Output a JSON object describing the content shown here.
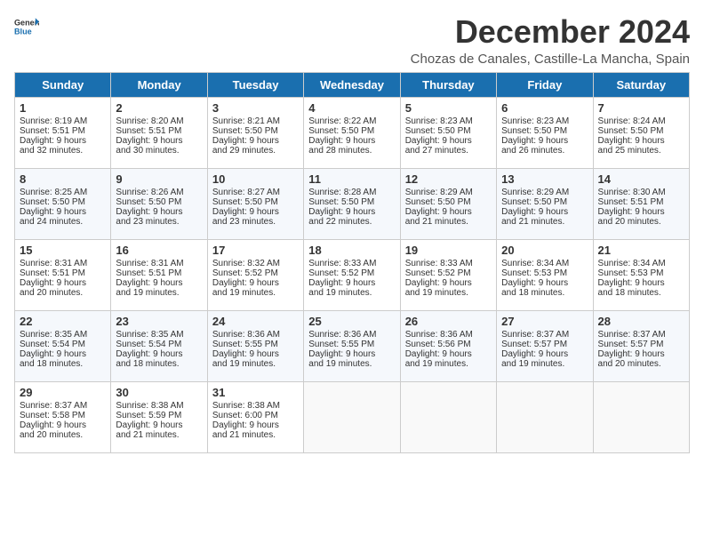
{
  "header": {
    "logo_general": "General",
    "logo_blue": "Blue",
    "title": "December 2024",
    "subtitle": "Chozas de Canales, Castille-La Mancha, Spain"
  },
  "weekdays": [
    "Sunday",
    "Monday",
    "Tuesday",
    "Wednesday",
    "Thursday",
    "Friday",
    "Saturday"
  ],
  "weeks": [
    [
      {
        "day": "1",
        "lines": [
          "Sunrise: 8:19 AM",
          "Sunset: 5:51 PM",
          "Daylight: 9 hours",
          "and 32 minutes."
        ]
      },
      {
        "day": "2",
        "lines": [
          "Sunrise: 8:20 AM",
          "Sunset: 5:51 PM",
          "Daylight: 9 hours",
          "and 30 minutes."
        ]
      },
      {
        "day": "3",
        "lines": [
          "Sunrise: 8:21 AM",
          "Sunset: 5:50 PM",
          "Daylight: 9 hours",
          "and 29 minutes."
        ]
      },
      {
        "day": "4",
        "lines": [
          "Sunrise: 8:22 AM",
          "Sunset: 5:50 PM",
          "Daylight: 9 hours",
          "and 28 minutes."
        ]
      },
      {
        "day": "5",
        "lines": [
          "Sunrise: 8:23 AM",
          "Sunset: 5:50 PM",
          "Daylight: 9 hours",
          "and 27 minutes."
        ]
      },
      {
        "day": "6",
        "lines": [
          "Sunrise: 8:23 AM",
          "Sunset: 5:50 PM",
          "Daylight: 9 hours",
          "and 26 minutes."
        ]
      },
      {
        "day": "7",
        "lines": [
          "Sunrise: 8:24 AM",
          "Sunset: 5:50 PM",
          "Daylight: 9 hours",
          "and 25 minutes."
        ]
      }
    ],
    [
      {
        "day": "8",
        "lines": [
          "Sunrise: 8:25 AM",
          "Sunset: 5:50 PM",
          "Daylight: 9 hours",
          "and 24 minutes."
        ]
      },
      {
        "day": "9",
        "lines": [
          "Sunrise: 8:26 AM",
          "Sunset: 5:50 PM",
          "Daylight: 9 hours",
          "and 23 minutes."
        ]
      },
      {
        "day": "10",
        "lines": [
          "Sunrise: 8:27 AM",
          "Sunset: 5:50 PM",
          "Daylight: 9 hours",
          "and 23 minutes."
        ]
      },
      {
        "day": "11",
        "lines": [
          "Sunrise: 8:28 AM",
          "Sunset: 5:50 PM",
          "Daylight: 9 hours",
          "and 22 minutes."
        ]
      },
      {
        "day": "12",
        "lines": [
          "Sunrise: 8:29 AM",
          "Sunset: 5:50 PM",
          "Daylight: 9 hours",
          "and 21 minutes."
        ]
      },
      {
        "day": "13",
        "lines": [
          "Sunrise: 8:29 AM",
          "Sunset: 5:50 PM",
          "Daylight: 9 hours",
          "and 21 minutes."
        ]
      },
      {
        "day": "14",
        "lines": [
          "Sunrise: 8:30 AM",
          "Sunset: 5:51 PM",
          "Daylight: 9 hours",
          "and 20 minutes."
        ]
      }
    ],
    [
      {
        "day": "15",
        "lines": [
          "Sunrise: 8:31 AM",
          "Sunset: 5:51 PM",
          "Daylight: 9 hours",
          "and 20 minutes."
        ]
      },
      {
        "day": "16",
        "lines": [
          "Sunrise: 8:31 AM",
          "Sunset: 5:51 PM",
          "Daylight: 9 hours",
          "and 19 minutes."
        ]
      },
      {
        "day": "17",
        "lines": [
          "Sunrise: 8:32 AM",
          "Sunset: 5:52 PM",
          "Daylight: 9 hours",
          "and 19 minutes."
        ]
      },
      {
        "day": "18",
        "lines": [
          "Sunrise: 8:33 AM",
          "Sunset: 5:52 PM",
          "Daylight: 9 hours",
          "and 19 minutes."
        ]
      },
      {
        "day": "19",
        "lines": [
          "Sunrise: 8:33 AM",
          "Sunset: 5:52 PM",
          "Daylight: 9 hours",
          "and 19 minutes."
        ]
      },
      {
        "day": "20",
        "lines": [
          "Sunrise: 8:34 AM",
          "Sunset: 5:53 PM",
          "Daylight: 9 hours",
          "and 18 minutes."
        ]
      },
      {
        "day": "21",
        "lines": [
          "Sunrise: 8:34 AM",
          "Sunset: 5:53 PM",
          "Daylight: 9 hours",
          "and 18 minutes."
        ]
      }
    ],
    [
      {
        "day": "22",
        "lines": [
          "Sunrise: 8:35 AM",
          "Sunset: 5:54 PM",
          "Daylight: 9 hours",
          "and 18 minutes."
        ]
      },
      {
        "day": "23",
        "lines": [
          "Sunrise: 8:35 AM",
          "Sunset: 5:54 PM",
          "Daylight: 9 hours",
          "and 18 minutes."
        ]
      },
      {
        "day": "24",
        "lines": [
          "Sunrise: 8:36 AM",
          "Sunset: 5:55 PM",
          "Daylight: 9 hours",
          "and 19 minutes."
        ]
      },
      {
        "day": "25",
        "lines": [
          "Sunrise: 8:36 AM",
          "Sunset: 5:55 PM",
          "Daylight: 9 hours",
          "and 19 minutes."
        ]
      },
      {
        "day": "26",
        "lines": [
          "Sunrise: 8:36 AM",
          "Sunset: 5:56 PM",
          "Daylight: 9 hours",
          "and 19 minutes."
        ]
      },
      {
        "day": "27",
        "lines": [
          "Sunrise: 8:37 AM",
          "Sunset: 5:57 PM",
          "Daylight: 9 hours",
          "and 19 minutes."
        ]
      },
      {
        "day": "28",
        "lines": [
          "Sunrise: 8:37 AM",
          "Sunset: 5:57 PM",
          "Daylight: 9 hours",
          "and 20 minutes."
        ]
      }
    ],
    [
      {
        "day": "29",
        "lines": [
          "Sunrise: 8:37 AM",
          "Sunset: 5:58 PM",
          "Daylight: 9 hours",
          "and 20 minutes."
        ]
      },
      {
        "day": "30",
        "lines": [
          "Sunrise: 8:38 AM",
          "Sunset: 5:59 PM",
          "Daylight: 9 hours",
          "and 21 minutes."
        ]
      },
      {
        "day": "31",
        "lines": [
          "Sunrise: 8:38 AM",
          "Sunset: 6:00 PM",
          "Daylight: 9 hours",
          "and 21 minutes."
        ]
      },
      null,
      null,
      null,
      null
    ]
  ]
}
